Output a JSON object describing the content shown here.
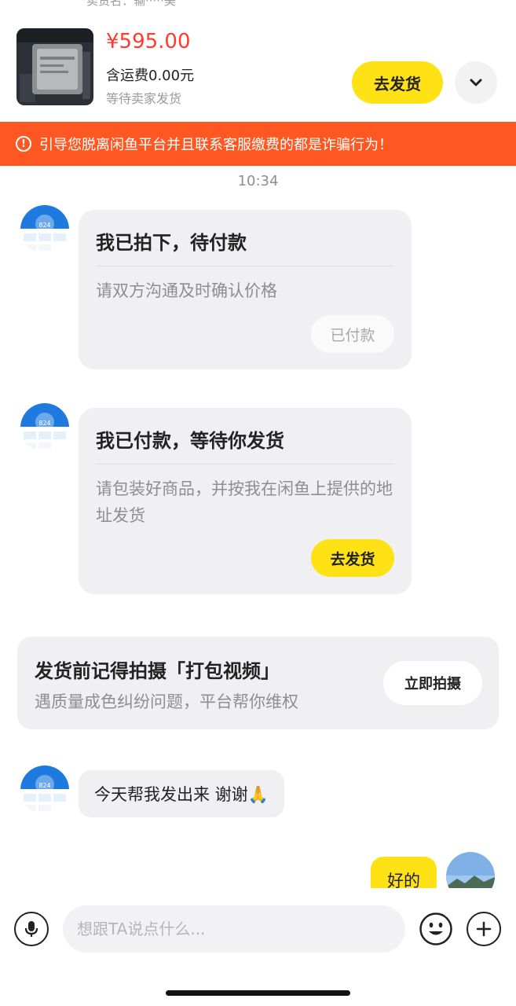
{
  "header": {
    "cut_text": "卖货名：输·····美"
  },
  "product": {
    "price": "¥595.00",
    "shipping": "含运费0.00元",
    "status": "等待卖家发货",
    "ship_button": "去发货"
  },
  "warning": {
    "text": "引导您脱离闲鱼平台并且联系客服缴费的都是诈骗行为！"
  },
  "chat": {
    "time": "10:34",
    "card1": {
      "title": "我已拍下，待付款",
      "desc": "请双方沟通及时确认价格",
      "button": "已付款"
    },
    "card2": {
      "title": "我已付款，等待你发货",
      "desc": "请包装好商品，并按我在闲鱼上提供的地址发货",
      "button": "去发货"
    },
    "tip": {
      "title": "发货前记得拍摄「打包视频」",
      "subtitle": "遇质量成色纠纷问题，平台帮你维权",
      "button": "立即拍摄"
    },
    "msg_in": "今天帮我发出来 谢谢🙏",
    "msg_out": "好的"
  },
  "input": {
    "placeholder": "想跟TA说点什么..."
  },
  "colors": {
    "accent_yellow": "#ffe215",
    "price_red": "#ff3b30",
    "warning_orange": "#ff5722"
  },
  "icons": [
    "chevron-down-icon",
    "warning-circle-icon",
    "microphone-icon",
    "emoji-icon",
    "plus-icon"
  ]
}
